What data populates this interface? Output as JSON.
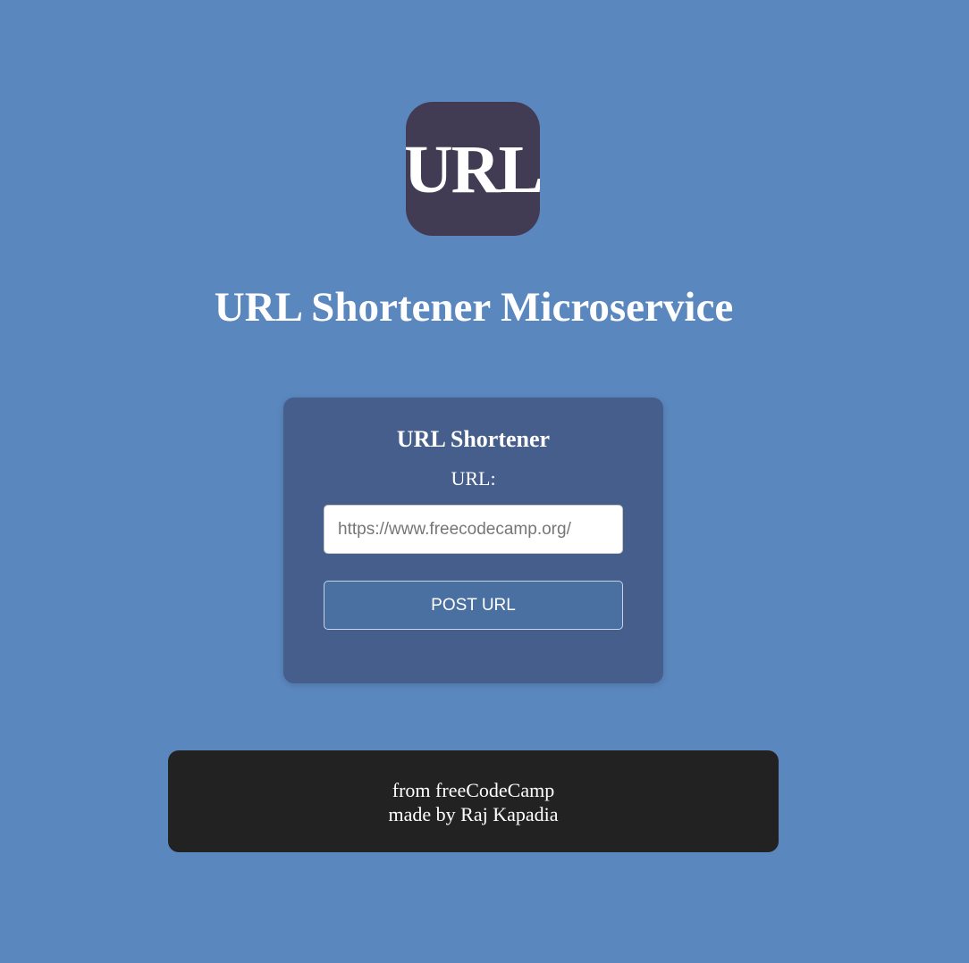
{
  "logo": {
    "text": "URL"
  },
  "page": {
    "title": "URL Shortener Microservice"
  },
  "form": {
    "title": "URL Shortener",
    "field_label": "URL:",
    "input_placeholder": "https://www.freecodecamp.org/",
    "input_value": "",
    "submit_label": "POST URL"
  },
  "footer": {
    "line1": "from freeCodeCamp",
    "line2": "made by Raj Kapadia"
  },
  "colors": {
    "background": "#5b87bf",
    "logo_bg": "#413c53",
    "card_bg": "#455e8c",
    "button_bg": "#4a70a2",
    "footer_bg": "#222222",
    "text": "#ffffff"
  }
}
